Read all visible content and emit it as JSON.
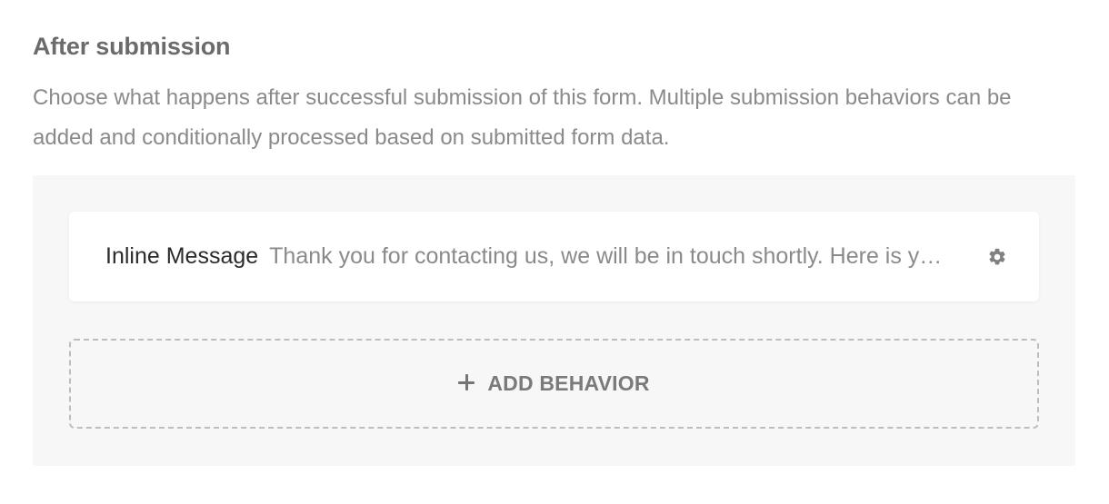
{
  "section": {
    "title": "After submission",
    "description": "Choose what happens after successful submission of this form. Multiple submission behaviors can be added and conditionally processed based on submitted form data."
  },
  "behaviors": [
    {
      "type": "Inline Message",
      "summary": "Thank you for contacting us, we will be in touch shortly. Here is y…",
      "settings_icon": "gear-icon"
    }
  ],
  "add_button": {
    "label": "ADD BEHAVIOR",
    "icon": "plus-icon"
  },
  "colors": {
    "panel_bg": "#f7f7f7",
    "card_bg": "#ffffff",
    "muted_text": "#8a8a8a",
    "dashed_border": "#bdbdbd"
  }
}
